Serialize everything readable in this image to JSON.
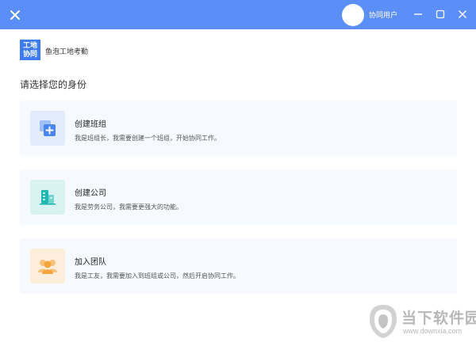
{
  "titlebar": {
    "user_name": "协同用户",
    "accent": "#5b8ff7"
  },
  "brand": {
    "logo_text_line1": "工地",
    "logo_text_line2": "协同",
    "app_name": "鱼泡工地考勤"
  },
  "prompt": "请选择您的身份",
  "options": [
    {
      "title": "创建班组",
      "description": "我是班组长，我需要创建一个班组，开始协同工作。",
      "icon": "add-team-icon",
      "icon_color": "#4a86f0"
    },
    {
      "title": "创建公司",
      "description": "我是劳务公司，我需要更强大的功能。",
      "icon": "company-building-icon",
      "icon_color": "#22b8b2"
    },
    {
      "title": "加入团队",
      "description": "我是工友，我需要加入到班组或公司，然后开启协同工作。",
      "icon": "join-team-icon",
      "icon_color": "#f5a33b"
    }
  ],
  "watermark": {
    "name": "当下软件园",
    "url": "www.downxia.com"
  }
}
